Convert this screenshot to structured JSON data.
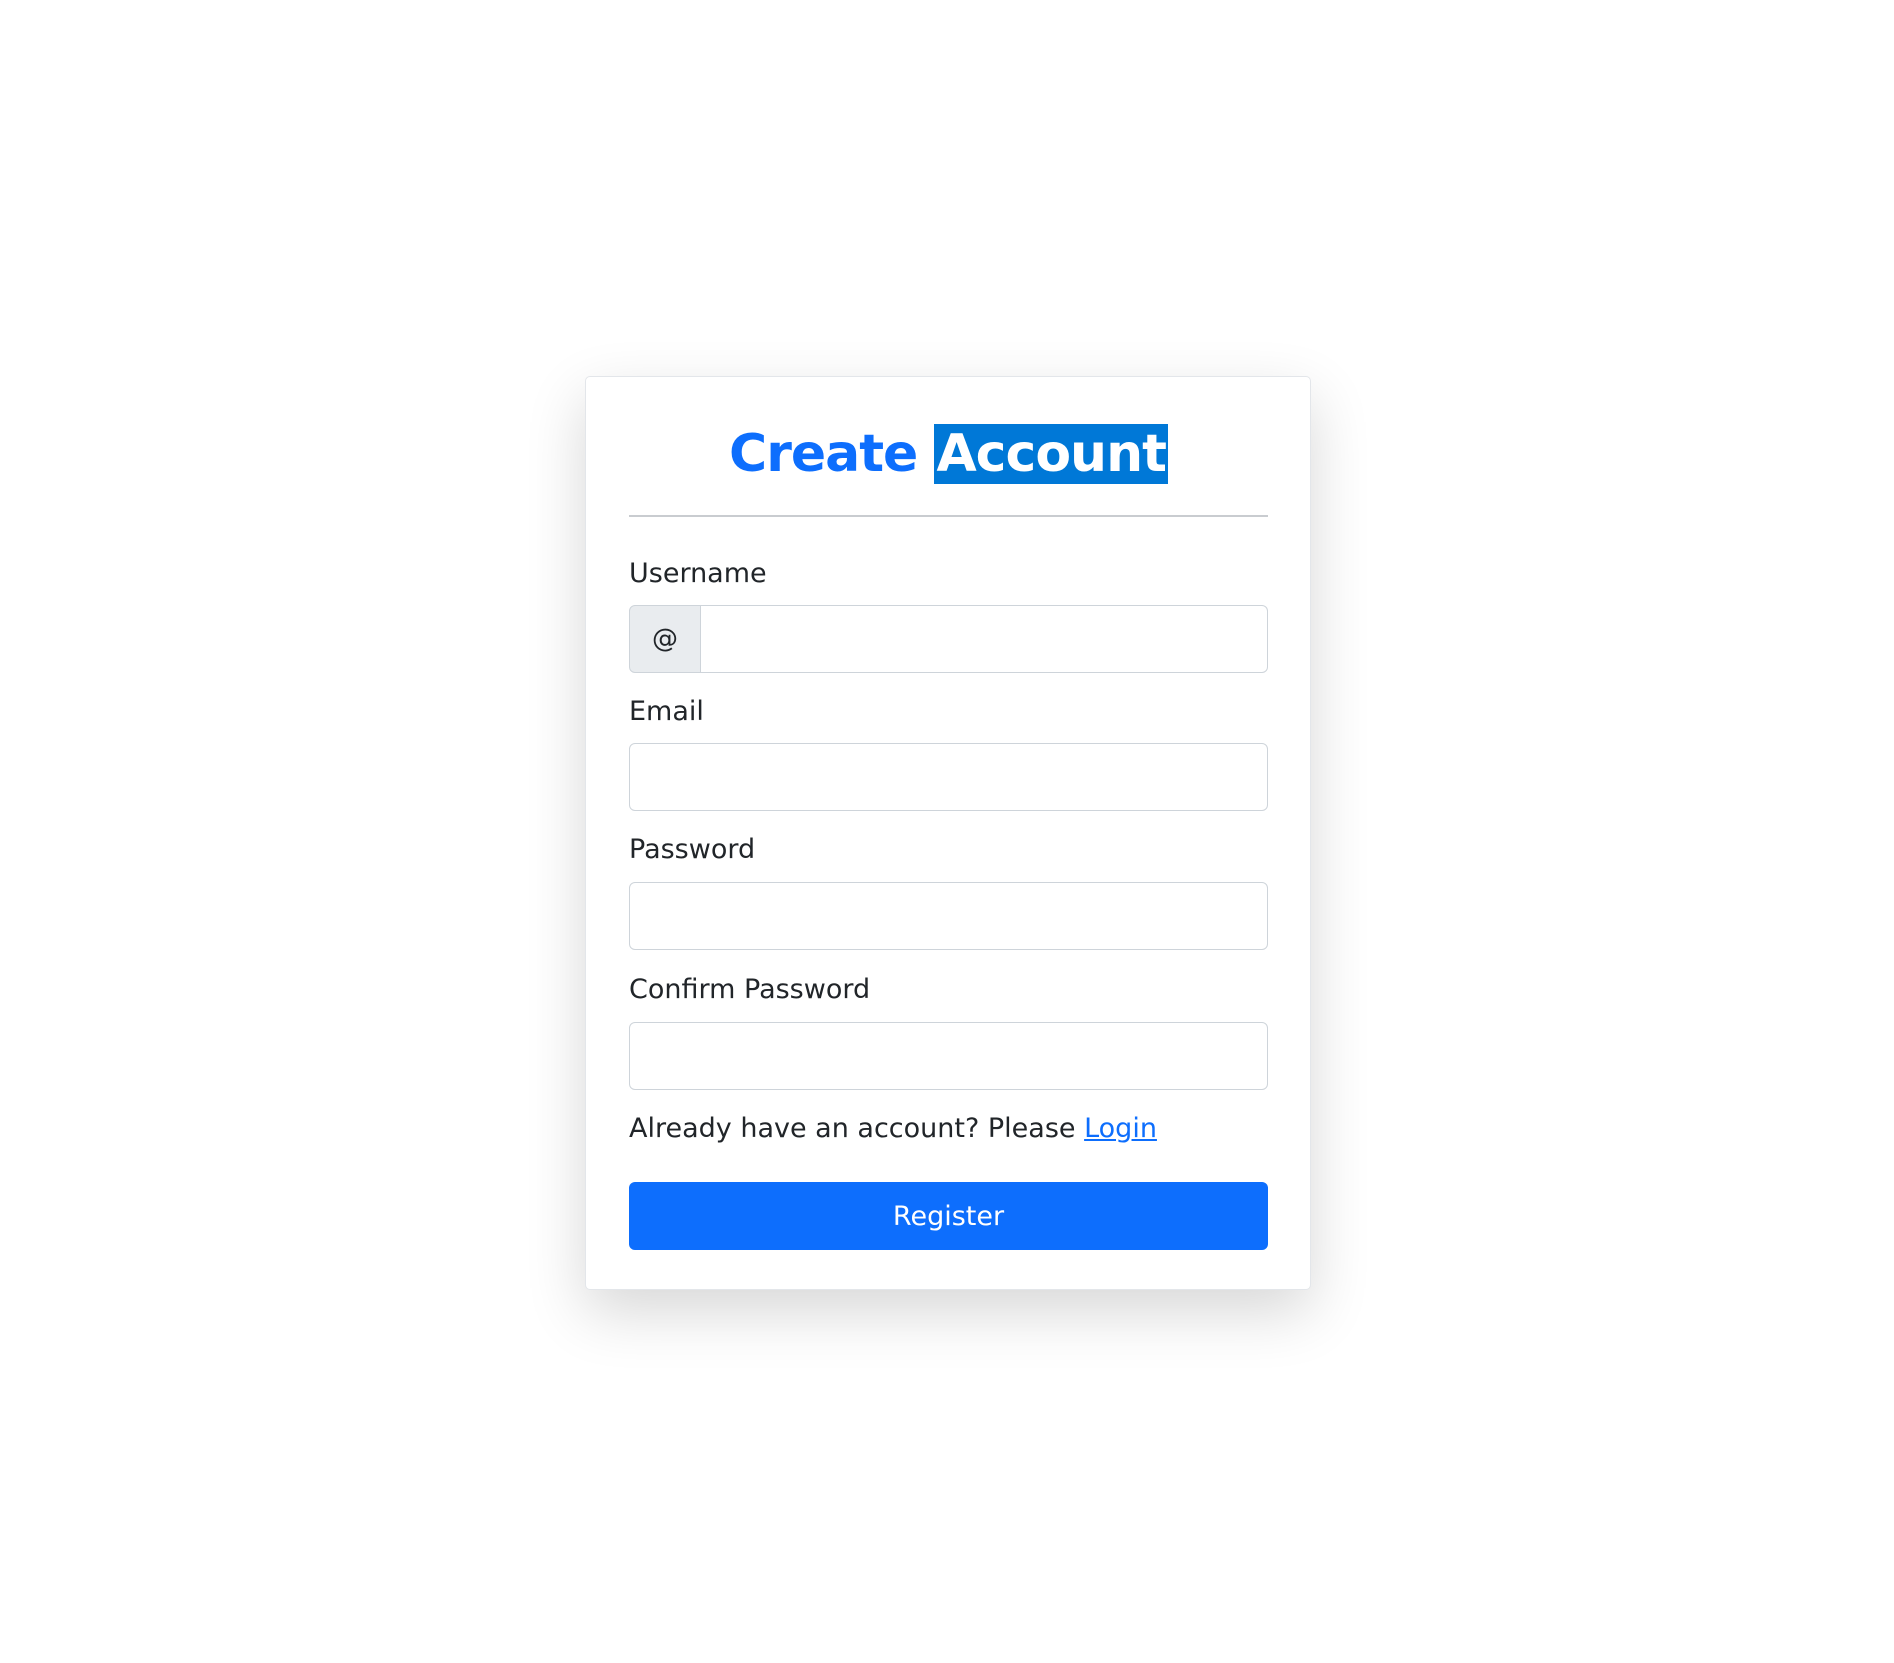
{
  "form": {
    "title_word_1": "Create",
    "title_word_2": "Account",
    "fields": {
      "username": {
        "label": "Username",
        "addon": "@",
        "value": "",
        "placeholder": ""
      },
      "email": {
        "label": "Email",
        "value": "",
        "placeholder": ""
      },
      "password": {
        "label": "Password",
        "value": "",
        "placeholder": ""
      },
      "confirm_password": {
        "label": "Confirm Password",
        "value": "",
        "placeholder": ""
      }
    },
    "login_prompt": "Already have an account? Please ",
    "login_link": "Login",
    "register_label": "Register"
  },
  "colors": {
    "primary": "#0d6efd",
    "selection_highlight": "#0078d7",
    "addon_background": "#e9ecef",
    "input_border": "#ced4da",
    "divider": "#c9ccd0",
    "text": "#212529"
  }
}
